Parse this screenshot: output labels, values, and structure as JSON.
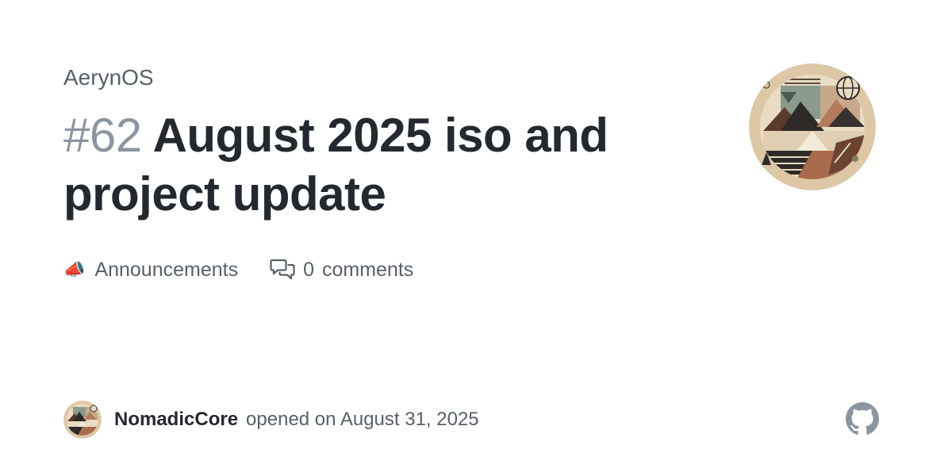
{
  "repo": {
    "owner": "AerynOS"
  },
  "discussion": {
    "number": "#62",
    "title": "August 2025 iso and project update",
    "category_emoji": "📣",
    "category": "Announcements",
    "comment_count": "0",
    "comment_label": "comments"
  },
  "author": {
    "name": "NomadicCore",
    "opened_text": "opened on August 31, 2025"
  },
  "icons": {
    "comment": "comment-discussion-icon",
    "github": "github-mark-icon"
  },
  "colors": {
    "title": "#24292f",
    "muted": "#57606a",
    "number": "#8c959f"
  }
}
